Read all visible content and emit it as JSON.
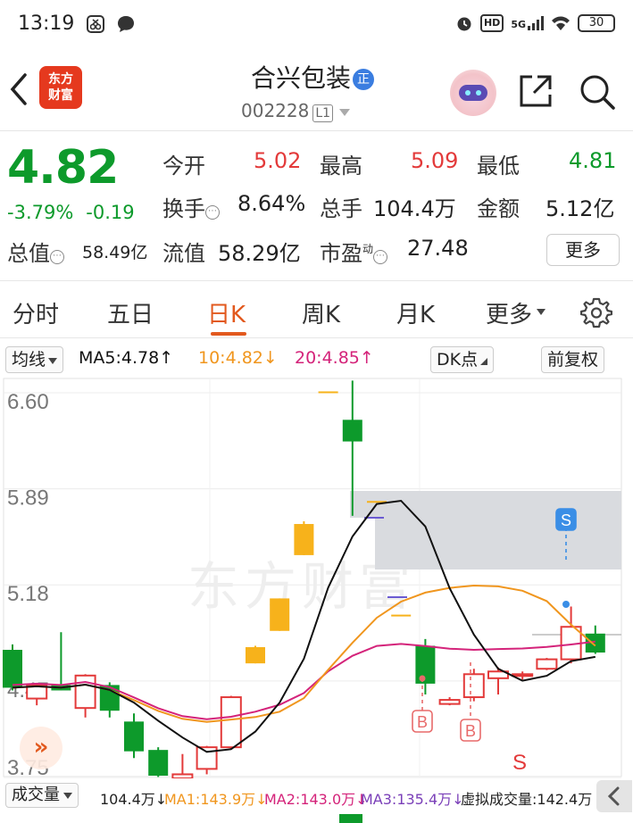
{
  "status_bar": {
    "time": "13:19",
    "icons_left": [
      "scissors-box-icon",
      "chat-bubble-icon"
    ],
    "icons_right": [
      "alarm-icon",
      "hd-icon",
      "5g-signal-icon",
      "wifi-icon"
    ],
    "hd": "HD",
    "net": "5G",
    "battery": "30"
  },
  "header": {
    "back_icon": "chevron-left-icon",
    "logo_line1": "东方",
    "logo_line2": "财富",
    "title": "合兴包装",
    "badge": "正",
    "code": "002228",
    "market": "L1"
  },
  "quote": {
    "price": "4.82",
    "change_pct": "-3.79%",
    "change": "-0.19",
    "open_label": "今开",
    "open": "5.02",
    "high_label": "最高",
    "high": "5.09",
    "low_label": "最低",
    "low": "4.81",
    "turnover_label": "换手",
    "turnover": "8.64%",
    "volume_label": "总手",
    "volume": "104.4万",
    "amount_label": "金额",
    "amount": "5.12亿",
    "mktcap_label": "总值",
    "mktcap": "58.49亿",
    "float_label": "流值",
    "float_cap": "58.29亿",
    "pe_label": "市盈",
    "pe_sup": "动",
    "pe": "27.48",
    "more": "更多"
  },
  "tabs": [
    "分时",
    "五日",
    "日K",
    "周K",
    "月K",
    "更多"
  ],
  "active_tab": "日K",
  "ma_bar": {
    "selector": "均线",
    "ma5": "MA5:4.78",
    "ma10": "10:4.82",
    "ma20": "20:4.85",
    "dk": "DK点",
    "adjust": "前复权"
  },
  "colors": {
    "up": "#e33a3a",
    "down": "#0d9a2b",
    "accent": "#e2591e",
    "ma5": "#111111",
    "ma10": "#f0961e",
    "ma20": "#d4237a",
    "candle_yellow": "#f7b21b"
  },
  "chart_data": {
    "type": "candlestick",
    "y_ticks": [
      "6.60",
      "5.89",
      "5.18",
      "4.47",
      "3.75"
    ],
    "ylim": [
      3.75,
      6.6
    ],
    "watermark": "东方财富",
    "markers": [
      "S",
      "B",
      "B",
      "S"
    ],
    "candles": [
      {
        "o": 4.7,
        "h": 4.74,
        "l": 4.4,
        "c": 4.42
      },
      {
        "o": 4.34,
        "h": 4.44,
        "l": 4.29,
        "c": 4.44
      },
      {
        "o": 4.44,
        "h": 4.83,
        "l": 4.4,
        "c": 4.4
      },
      {
        "o": 4.27,
        "h": 4.52,
        "l": 4.2,
        "c": 4.51
      },
      {
        "o": 4.44,
        "h": 4.46,
        "l": 4.2,
        "c": 4.25
      },
      {
        "o": 4.17,
        "h": 4.23,
        "l": 3.9,
        "c": 3.95
      },
      {
        "o": 3.96,
        "h": 3.98,
        "l": 3.76,
        "c": 3.77
      },
      {
        "o": 3.75,
        "h": 3.93,
        "l": 3.72,
        "c": 3.78
      },
      {
        "o": 3.82,
        "h": 3.99,
        "l": 3.78,
        "c": 3.98
      },
      {
        "o": 3.98,
        "h": 4.36,
        "l": 3.97,
        "c": 4.35
      },
      {
        "o": 4.72,
        "h": 4.73,
        "l": 4.6,
        "c": 4.6
      },
      {
        "o": 5.08,
        "h": 5.08,
        "l": 4.84,
        "c": 4.84
      },
      {
        "o": 5.63,
        "h": 5.65,
        "l": 5.4,
        "c": 5.4
      },
      {
        "o": 6.61,
        "h": 6.61,
        "l": 6.61,
        "c": 6.61
      },
      {
        "o": 6.4,
        "h": 6.69,
        "l": 5.69,
        "c": 6.24
      },
      {
        "o": 5.8,
        "h": 5.8,
        "l": 5.8,
        "c": 5.8
      },
      {
        "o": 4.96,
        "h": 4.96,
        "l": 4.96,
        "c": 4.96
      },
      {
        "o": 4.73,
        "h": 4.78,
        "l": 4.37,
        "c": 4.45
      },
      {
        "o": 4.3,
        "h": 4.35,
        "l": 4.29,
        "c": 4.33
      },
      {
        "o": 4.35,
        "h": 4.56,
        "l": 4.32,
        "c": 4.52
      },
      {
        "o": 4.49,
        "h": 4.57,
        "l": 4.37,
        "c": 4.54
      },
      {
        "o": 4.52,
        "h": 4.54,
        "l": 4.48,
        "c": 4.52
      },
      {
        "o": 4.56,
        "h": 4.64,
        "l": 4.55,
        "c": 4.63
      },
      {
        "o": 4.63,
        "h": 5.02,
        "l": 4.6,
        "c": 4.87
      },
      {
        "o": 4.82,
        "h": 4.88,
        "l": 4.67,
        "c": 4.68
      }
    ]
  },
  "volume_bar": {
    "selector": "成交量",
    "vol": "104.4万↓",
    "ma1": "MA1:143.9万↓",
    "ma2": "MA2:143.0万↓",
    "ma3": "MA3:135.4万↓",
    "virtual": "虚拟成交量:142.4万"
  }
}
